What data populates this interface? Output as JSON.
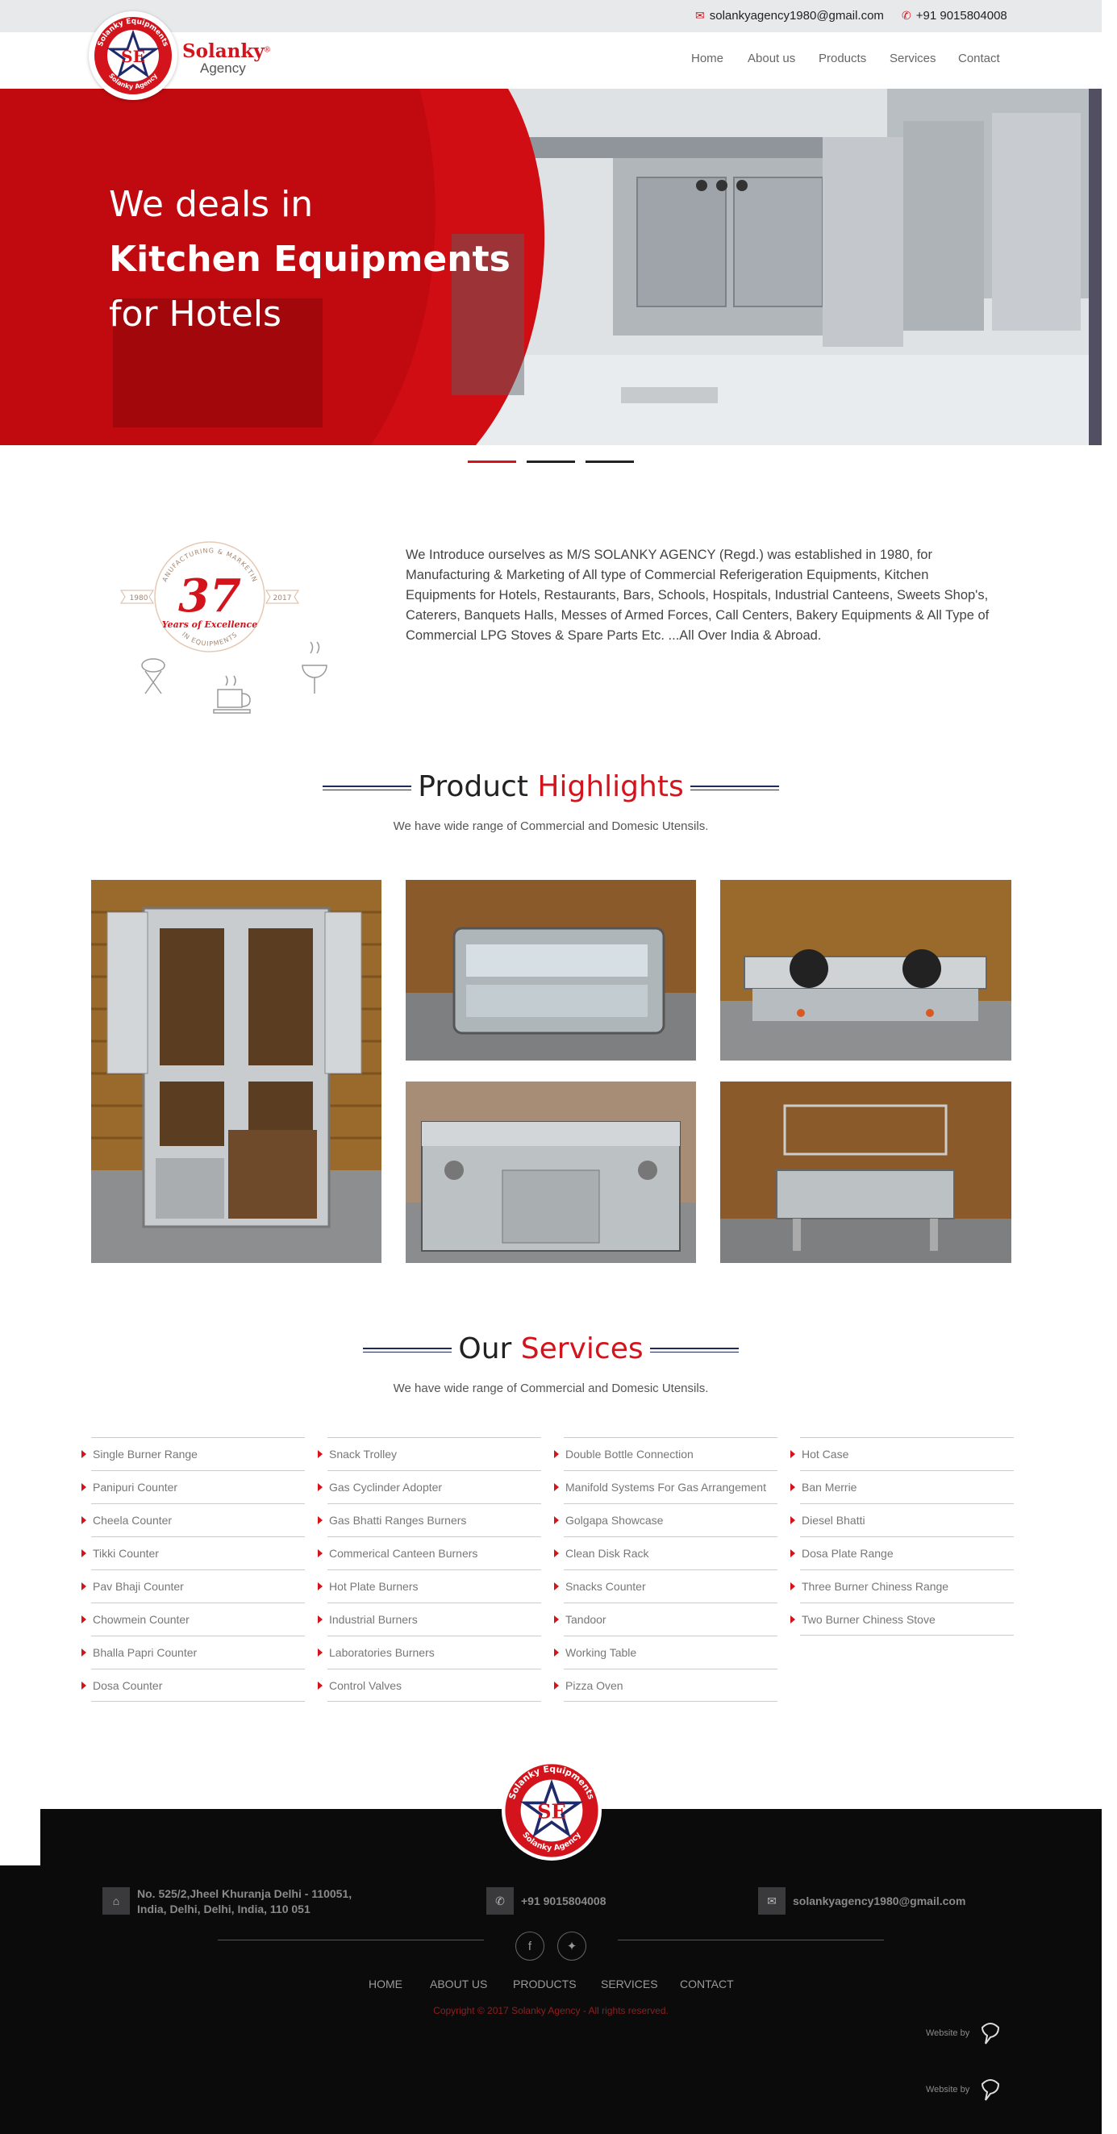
{
  "topbar": {
    "email": "solankyagency1980@gmail.com",
    "phone": "+91 9015804008",
    "email_icon": "envelope-icon",
    "phone_icon": "phone-icon"
  },
  "brand": {
    "name": "Solanky",
    "reg": "®",
    "sub": "Agency",
    "logo_top_text": "Solanky Equipments",
    "logo_bottom_text": "Solanky Agency",
    "logo_monogram": "SE"
  },
  "nav": [
    "Home",
    "About us",
    "Products",
    "Services",
    "Contact"
  ],
  "hero": {
    "line1": "We deals in",
    "line2": "Kitchen Equipments",
    "line3": "for Hotels"
  },
  "slider": {
    "count": 3,
    "active": 0
  },
  "badge": {
    "number": "37",
    "script": "Years of Excellence",
    "arc_top": "MANUFACTURING & MARKETING",
    "arc_bottom": "IN EQUIPMENTS",
    "year_left": "1980",
    "year_right": "2017"
  },
  "about": "We Introduce ourselves as M/S SOLANKY AGENCY (Regd.) was established in 1980, for Manufacturing & Marketing of All type of Commercial Referigeration Equipments, Kitchen Equipments for Hotels, Restaurants, Bars, Schools, Hospitals, Industrial Canteens, Sweets Shop's, Caterers, Banquets Halls, Messes of Armed Forces, Call Centers, Bakery Equipments & All Type of Commercial LPG Stoves & Spare Parts Etc. ...All Over India & Abroad.",
  "products": {
    "title_a": "Product",
    "title_b": "Highlights",
    "subtitle": "We have wide range of Commercial and Domesic Utensils."
  },
  "services": {
    "title_a": "Our",
    "title_b": "Services",
    "subtitle": "We have wide range of Commercial and Domesic Utensils.",
    "columns": [
      [
        "Single Burner Range",
        "Panipuri Counter",
        "Cheela Counter",
        "Tikki Counter",
        "Pav Bhaji Counter",
        "Chowmein Counter",
        "Bhalla Papri Counter",
        "Dosa Counter"
      ],
      [
        "Snack Trolley",
        "Gas Cyclinder Adopter",
        "Gas Bhatti Ranges Burners",
        "Commerical Canteen Burners",
        "Hot Plate Burners",
        "Industrial Burners",
        "Laboratories Burners",
        "Control Valves"
      ],
      [
        "Double Bottle Connection",
        "Manifold Systems For Gas Arrangement",
        "Golgapa Showcase",
        "Clean Disk Rack",
        "Snacks Counter",
        "Tandoor",
        "Working Table",
        "Pizza Oven"
      ],
      [
        "Hot Case",
        "Ban Merrie",
        "Diesel Bhatti",
        "Dosa Plate Range",
        "Three Burner Chiness Range",
        "Two Burner Chiness Stove"
      ]
    ]
  },
  "footer": {
    "address": "No. 525/2,Jheel Khuranja Delhi - 110051, India, Delhi, Delhi, India, 110 051",
    "phone": "+91 9015804008",
    "email": "solankyagency1980@gmail.com",
    "nav": [
      "HOME",
      "ABOUT US",
      "PRODUCTS",
      "SERVICES",
      "CONTACT"
    ],
    "copyright": "Copyright © 2017 Solanky Agency - All rights reserved.",
    "website_by": "Website by"
  },
  "colors": {
    "accent": "#d4141c",
    "footer_bg": "#0b0b0c",
    "topbar_bg": "#e8e9eb"
  }
}
